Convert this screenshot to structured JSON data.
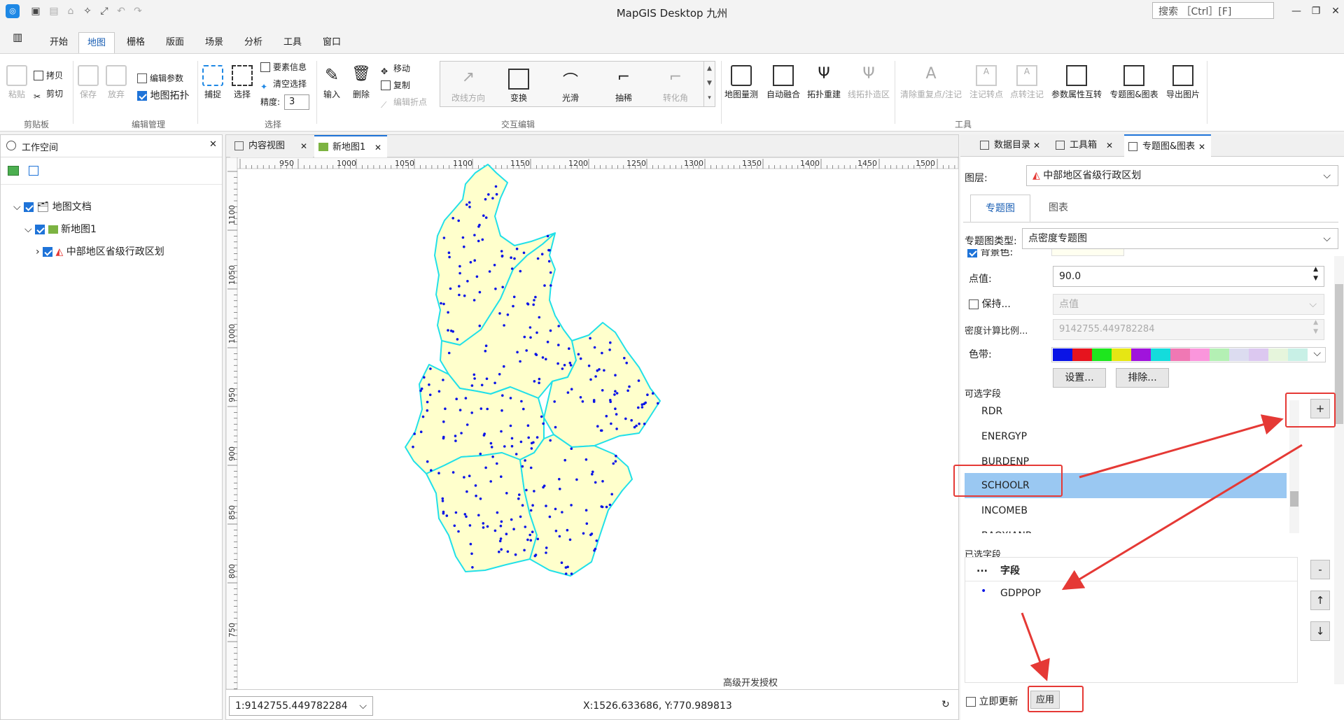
{
  "app": {
    "title": "MapGIS Desktop 九州",
    "search_placeholder": "搜索 ［Ctrl］[F]"
  },
  "menu": [
    "开始",
    "地图",
    "栅格",
    "版面",
    "场景",
    "分析",
    "工具",
    "窗口"
  ],
  "menu_active": "地图",
  "ribbon": {
    "clipboard": {
      "paste": "粘贴",
      "copy": "拷贝",
      "cut": "剪切",
      "group": "剪贴板"
    },
    "edit_mgmt": {
      "save": "保存",
      "discard": "放弃",
      "edit_params": "编辑参数",
      "map_topo": "地图拓扑",
      "group": "编辑管理"
    },
    "select": {
      "capture": "捕捉",
      "select": "选择",
      "element_info": "要素信息",
      "clear_select": "清空选择",
      "precision_label": "精度:",
      "precision_value": "3",
      "group": "选择"
    },
    "edit": {
      "input": "输入",
      "delete": "删除",
      "move": "移动",
      "copy": "复制",
      "edit_fold": "编辑折点"
    },
    "interactive": {
      "items": [
        "改线方向",
        "变换",
        "光滑",
        "抽稀",
        "转化角"
      ],
      "group": "交互编辑"
    },
    "tools": {
      "items": [
        "地图量测",
        "自动融合",
        "拓扑重建",
        "线拓扑造区",
        "清除重复点/注记",
        "注记转点",
        "点转注记",
        "参数属性互转",
        "专题图&图表",
        "导出图片"
      ],
      "group": "工具"
    }
  },
  "workspace": {
    "title": "工作空间",
    "tree": [
      "地图文档",
      "新地图1",
      "中部地区省级行政区划"
    ]
  },
  "doc_tabs": [
    "内容视图",
    "新地图1"
  ],
  "ruler_x": [
    "950",
    "1000",
    "1050",
    "1100",
    "1150",
    "1200",
    "1250",
    "1300",
    "1350",
    "1400",
    "1450",
    "1500"
  ],
  "ruler_y": [
    "1100",
    "1050",
    "1000",
    "950",
    "900",
    "850",
    "800",
    "750"
  ],
  "status": {
    "scale": "1:9142755.449782284",
    "coords": "X:1526.633686, Y:770.989813",
    "license": "高级开发授权"
  },
  "side_tabs": [
    "数据目录",
    "工具箱",
    "专题图&图表"
  ],
  "theme": {
    "layer_label": "图层:",
    "layer_value": "中部地区省级行政区划",
    "tab_theme": "专题图",
    "tab_chart": "图表",
    "type_label": "专题图类型:",
    "type_value": "点密度专题图",
    "bg_label": "背景色:",
    "point_value_label": "点值:",
    "point_value": "90.0",
    "keep_label": "保持...",
    "keep_value": "点值",
    "density_label": "密度计算比例...",
    "density_value": "9142755.449782284",
    "ramp_label": "色带:",
    "ramp_colors": [
      "#0a14e6",
      "#e6141e",
      "#1ee61e",
      "#e6e614",
      "#a014dc",
      "#14dcdc",
      "#f078b4",
      "#fa96dc",
      "#b4f0b4",
      "#dcdcf0",
      "#dcc8f0",
      "#e6f5dc",
      "#c8f0e6"
    ],
    "settings_btn": "设置...",
    "exclude_btn": "排除...",
    "available_label": "可选字段",
    "available_fields": [
      "RDR",
      "ENERGYP",
      "BURDENP",
      "SCHOOLR",
      "INCOMEB",
      "BAOXIANR"
    ],
    "selected_field": "SCHOOLR",
    "chosen_label": "已选字段",
    "chosen_header_dots": "...",
    "chosen_header": "字段",
    "chosen_fields": [
      "GDPPOP"
    ],
    "add_btn": "+",
    "remove_btn": "-",
    "up_btn": "↑",
    "down_btn": "↓",
    "auto_update": "立即更新",
    "apply": "应用"
  }
}
